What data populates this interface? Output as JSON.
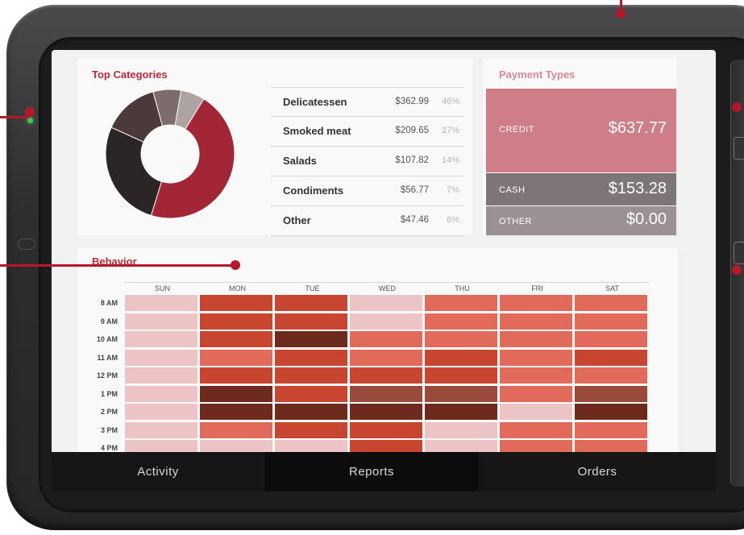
{
  "colors": {
    "accent": "#c0283a",
    "credit": "#cf7d87",
    "cash": "#7e7676",
    "other": "#9b9092",
    "callout": "#b5172b"
  },
  "top_categories": {
    "title": "Top Categories",
    "rows": [
      {
        "name": "Delicatessen",
        "amount": "$362.99",
        "pct": "46%"
      },
      {
        "name": "Smoked meat",
        "amount": "$209.65",
        "pct": "27%"
      },
      {
        "name": "Salads",
        "amount": "$107.82",
        "pct": "14%"
      },
      {
        "name": "Condiments",
        "amount": "$56.77",
        "pct": "7%"
      },
      {
        "name": "Other",
        "amount": "$47.46",
        "pct": "6%"
      }
    ]
  },
  "chart_data": {
    "type": "pie",
    "categories": [
      "Delicatessen",
      "Smoked meat",
      "Salads",
      "Condiments",
      "Other"
    ],
    "values": [
      46,
      27,
      14,
      7,
      6
    ],
    "colors": [
      "#a32636",
      "#2c2526",
      "#4a3a3a",
      "#7c6c6c",
      "#aea3a3"
    ]
  },
  "payment_types": {
    "title": "Payment Types",
    "rows": [
      {
        "label": "CREDIT",
        "value": "$637.77"
      },
      {
        "label": "CASH",
        "value": "$153.28"
      },
      {
        "label": "OTHER",
        "value": "$0.00"
      }
    ]
  },
  "behavior": {
    "title": "Behavior",
    "days": [
      "SUN",
      "MON",
      "TUE",
      "WED",
      "THU",
      "FRI",
      "SAT"
    ],
    "hours": [
      "8 AM",
      "9 AM",
      "10 AM",
      "11 AM",
      "12 PM",
      "1 PM",
      "2 PM",
      "3 PM",
      "4 PM"
    ],
    "heat_levels": [
      [
        1,
        4,
        4,
        1,
        3,
        3,
        3
      ],
      [
        1,
        4,
        4,
        1,
        3,
        3,
        3
      ],
      [
        1,
        4,
        6,
        3,
        3,
        3,
        3
      ],
      [
        1,
        3,
        4,
        3,
        4,
        3,
        4
      ],
      [
        1,
        4,
        4,
        4,
        4,
        3,
        3
      ],
      [
        1,
        6,
        4,
        5,
        5,
        3,
        5
      ],
      [
        1,
        6,
        6,
        6,
        6,
        1,
        6
      ],
      [
        1,
        3,
        4,
        4,
        1,
        3,
        3
      ],
      [
        1,
        1,
        1,
        4,
        1,
        3,
        3
      ]
    ],
    "palette": [
      "#ffffff",
      "#ecc4c6",
      "#e99a92",
      "#e26a5a",
      "#c8452f",
      "#9a4a3a",
      "#6d2a1d"
    ]
  },
  "tabs": [
    {
      "label": "Activity",
      "active": false
    },
    {
      "label": "Reports",
      "active": true
    },
    {
      "label": "Orders",
      "active": false
    }
  ]
}
